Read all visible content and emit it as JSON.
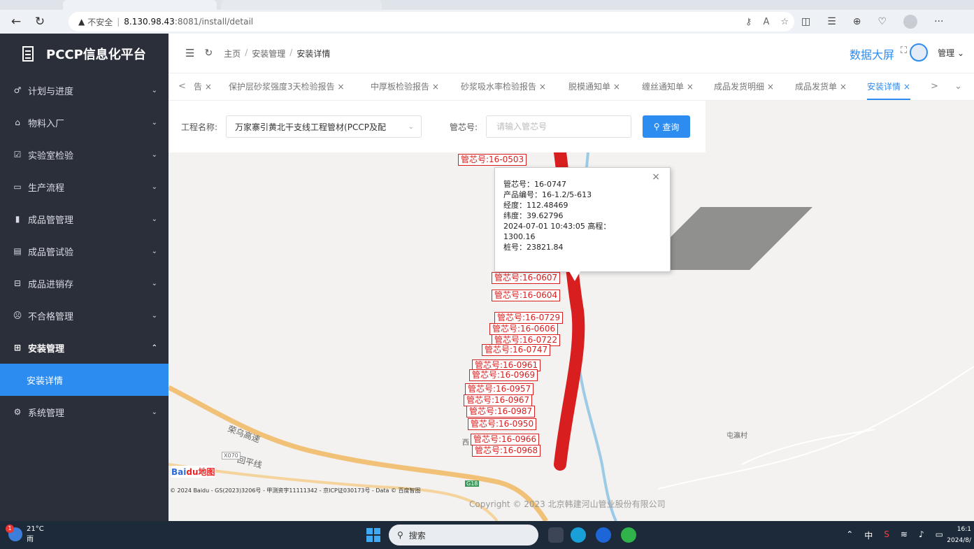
{
  "browser": {
    "url_warning": "不安全",
    "url_host": "8.130.98.43",
    "url_path": ":8081/install/detail",
    "url_separator": "|",
    "more_label": "···"
  },
  "sidebar": {
    "brand": "PCCP信息化平台",
    "items": [
      {
        "label": "计划与进度",
        "icon": "plan-icon"
      },
      {
        "label": "物料入厂",
        "icon": "material-icon"
      },
      {
        "label": "实验室检验",
        "icon": "lab-icon"
      },
      {
        "label": "生产流程",
        "icon": "production-icon"
      },
      {
        "label": "成品管管理",
        "icon": "pipe-icon"
      },
      {
        "label": "成品管试验",
        "icon": "test-icon"
      },
      {
        "label": "成品进销存",
        "icon": "inventory-icon"
      },
      {
        "label": "不合格管理",
        "icon": "unqualified-icon"
      },
      {
        "label": "安装管理",
        "icon": "install-icon"
      },
      {
        "label": "安装详情",
        "icon": ""
      },
      {
        "label": "系统管理",
        "icon": "settings-icon"
      }
    ]
  },
  "header": {
    "breadcrumb": [
      "主页",
      "安装管理",
      "安装详情"
    ],
    "big_screen": "数据大屏",
    "user": "管理"
  },
  "tabs": {
    "items": [
      "告",
      "保护层砂浆强度3天检验报告",
      "中厚板检验报告",
      "砂浆吸水率检验报告",
      "脱模通知单",
      "缠丝通知单",
      "成品发货明细",
      "成品发货单",
      "安装详情"
    ],
    "close": "×",
    "prev": "<",
    "next": ">"
  },
  "search": {
    "project_label": "工程名称:",
    "project_value": "万家寨引黄北干支线工程管材(PCCP及配",
    "pipe_label": "管芯号:",
    "pipe_placeholder": "请输入管芯号",
    "button": "查询"
  },
  "map": {
    "labels": [
      "管芯号:16-0503",
      "管芯号:16-0607",
      "管芯号:16-0604",
      "管芯号:16-0729",
      "管芯号:16-0606",
      "管芯号:16-0722",
      "管芯号:16-0747",
      "管芯号:16-0961",
      "管芯号:16-0969",
      "管芯号:16-0957",
      "管芯号:16-0967",
      "管芯号:16-0987",
      "管芯号:16-0950",
      "管芯号:16-0966",
      "管芯号:16-0968"
    ],
    "places": {
      "highway": "荣乌高速",
      "road": "回平线",
      "village": "屯瀛村",
      "road_sign": "X070",
      "west": "西",
      "g_sign": "G18"
    },
    "attribution": "© 2024 Baidu - GS(2023)3206号 - 甲测资字11111342 - 京ICP证030173号 - Data © 百度智图",
    "baidu": "Bai",
    "baidu_red": "du地图",
    "copyright": "Copyright © 2023 北京韩建河山管业股份有限公司"
  },
  "popup": {
    "lines": [
      "管芯号：16-0747",
      "产品编号：16-1.2/5-613",
      "经度：112.48469",
      "纬度：39.62796",
      "2024-07-01 10:43:05 高程：",
      "1300.16",
      "桩号：23821.84"
    ]
  },
  "taskbar": {
    "temp": "21°C",
    "weather": "雨",
    "search": "搜索",
    "ime": "中",
    "time": "16:1",
    "date": "2024/8/"
  },
  "colors": {
    "accent": "#2d8cf0",
    "sidebar": "#2b2f3a",
    "marker": "#d81e1e"
  }
}
